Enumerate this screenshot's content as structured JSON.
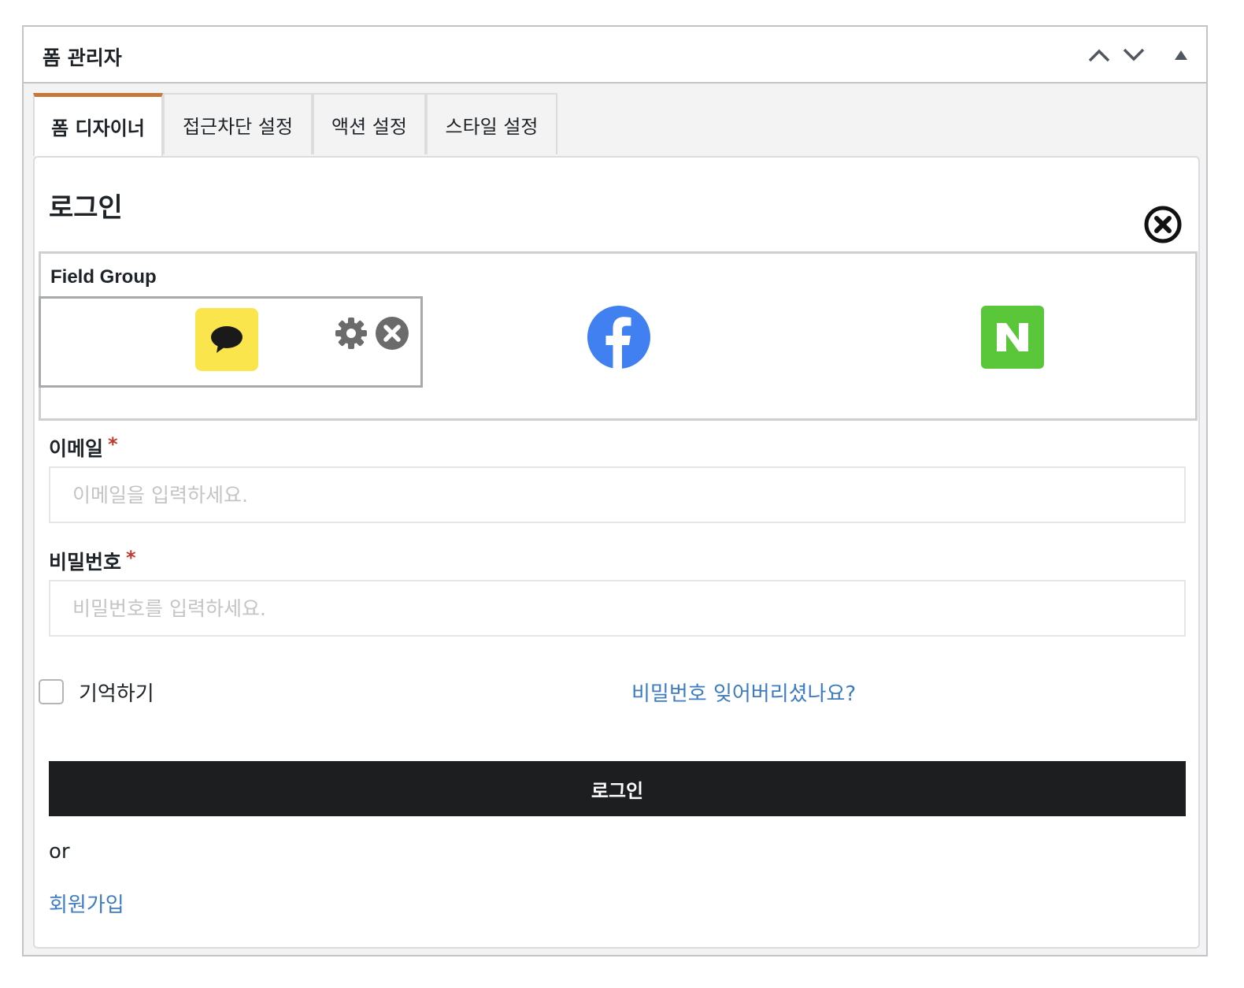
{
  "panel": {
    "title": "폼 관리자",
    "icons": [
      "chevron-up-icon",
      "chevron-down-icon",
      "triangle-up-icon"
    ]
  },
  "tabs": [
    {
      "label": "폼 디자이너",
      "active": true
    },
    {
      "label": "접근차단 설정",
      "active": false
    },
    {
      "label": "액션 설정",
      "active": false
    },
    {
      "label": "스타일 설정",
      "active": false
    }
  ],
  "form": {
    "title": "로그인",
    "field_group": {
      "label": "Field Group",
      "providers": [
        {
          "name": "kakao",
          "icon": "kakao-chat-bubble-icon",
          "color": "#fae64c"
        },
        {
          "name": "facebook",
          "icon": "facebook-icon",
          "color": "#4080f0"
        },
        {
          "name": "naver",
          "icon": "naver-n-icon",
          "color": "#5ac63a"
        }
      ]
    },
    "email": {
      "label": "이메일",
      "required_mark": "*",
      "placeholder": "이메일을 입력하세요.",
      "value": ""
    },
    "password": {
      "label": "비밀번호",
      "required_mark": "*",
      "placeholder": "비밀번호를 입력하세요.",
      "value": ""
    },
    "remember_label": "기억하기",
    "forgot_link": "비밀번호 잊어버리셨나요?",
    "submit_label": "로그인",
    "or_text": "or",
    "signup_link": "회원가입"
  },
  "colors": {
    "accent_tab": "#c6783b",
    "link": "#3d7bc3",
    "button_bg": "#1d1e20",
    "required": "#c0392b"
  }
}
